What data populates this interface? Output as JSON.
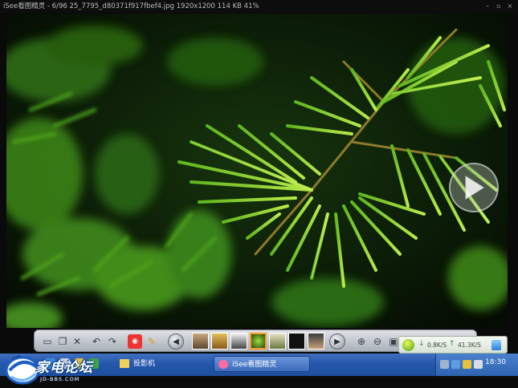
{
  "window": {
    "title": "iSee看图精灵 - 6/96  25_7795_d80371f917fbef4.jpg  1920x1200  114 KB  41%"
  },
  "window_controls": [
    "minimize",
    "restore",
    "close"
  ],
  "viewer": {
    "next_arrow_icon": "play-arrow-icon",
    "accent": "#ff9a2a"
  },
  "toolbar": {
    "buttons": [
      "open-folder-icon",
      "copy-icon",
      "delete-icon",
      "rotate-left-icon",
      "rotate-right-icon",
      "red-eye-icon",
      "clean-brush-icon",
      "prev-icon",
      "next-icon",
      "zoom-in-icon",
      "zoom-out-icon",
      "fit-icon",
      "more-icon"
    ],
    "thumbnail_count": 7,
    "active_thumbnail_index": 3
  },
  "net_speed": {
    "download": "0.8K/S",
    "upload": "41.3K/S"
  },
  "taskbar": {
    "tasks": [
      {
        "label": "投影机",
        "active": false
      },
      {
        "label": "iSee看图精灵",
        "active": true
      }
    ],
    "clock": "18:30"
  },
  "watermark": {
    "title": "家电论坛",
    "url": "JD-BBS.COM"
  }
}
